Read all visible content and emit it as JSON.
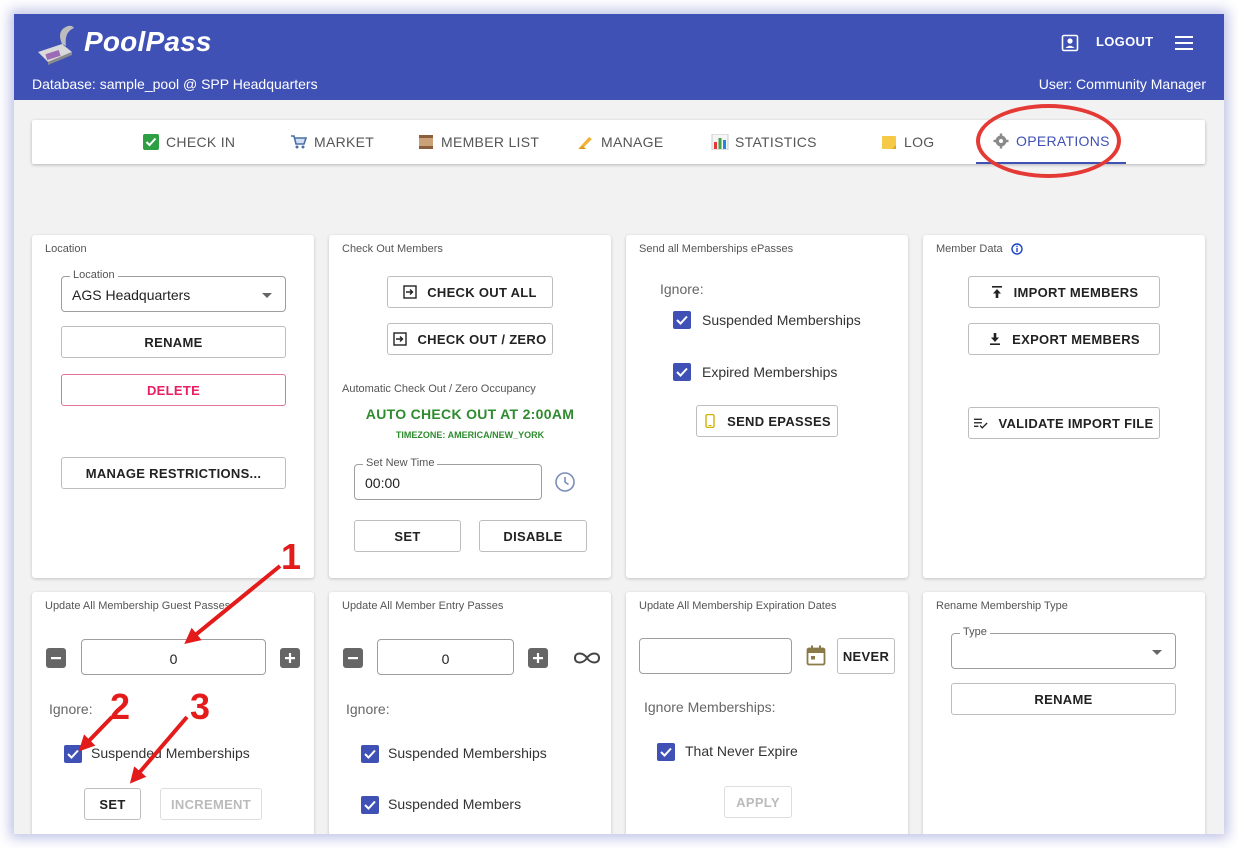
{
  "app": {
    "title": "PoolPass",
    "database_line": "Database: sample_pool @ SPP Headquarters",
    "user_line": "User: Community Manager",
    "logout_label": "LOGOUT",
    "brand_color": "#3f51b5"
  },
  "tabs": [
    {
      "label": "CHECK IN",
      "icon": "check-box-icon"
    },
    {
      "label": "MARKET",
      "icon": "cart-icon"
    },
    {
      "label": "MEMBER LIST",
      "icon": "scroll-icon"
    },
    {
      "label": "MANAGE",
      "icon": "pencil-hand-icon"
    },
    {
      "label": "STATISTICS",
      "icon": "bar-chart-icon"
    },
    {
      "label": "LOG",
      "icon": "note-icon"
    },
    {
      "label": "OPERATIONS",
      "icon": "gear-icon",
      "active": true
    }
  ],
  "location": {
    "title": "Location",
    "field_label": "Location",
    "value": "AGS Headquarters",
    "rename_label": "RENAME",
    "delete_label": "DELETE",
    "restrictions_label": "MANAGE RESTRICTIONS..."
  },
  "checkout": {
    "title": "Check Out Members",
    "check_out_all_label": "CHECK OUT ALL",
    "check_out_zero_label": "CHECK OUT / ZERO",
    "auto_title": "Automatic Check Out / Zero Occupancy",
    "auto_status": "AUTO CHECK OUT AT 2:00AM",
    "timezone": "TIMEZONE: AMERICA/NEW_YORK",
    "time_field_label": "Set New Time",
    "time_value": "00:00",
    "set_label": "SET",
    "disable_label": "DISABLE"
  },
  "epasses": {
    "title": "Send all Memberships ePasses",
    "ignore_label": "Ignore:",
    "opt1": "Suspended Memberships",
    "opt2": "Expired Memberships",
    "send_label": "SEND EPASSES"
  },
  "member_data": {
    "title": "Member Data",
    "import_label": "IMPORT MEMBERS",
    "export_label": "EXPORT MEMBERS",
    "validate_label": "VALIDATE IMPORT FILE"
  },
  "guest_passes": {
    "title": "Update All Membership Guest Passes",
    "value": "0",
    "ignore_label": "Ignore:",
    "opt1": "Suspended Memberships",
    "set_label": "SET",
    "increment_label": "INCREMENT"
  },
  "entry_passes": {
    "title": "Update All Member Entry Passes",
    "value": "0",
    "ignore_label": "Ignore:",
    "opt1": "Suspended Memberships",
    "opt2": "Suspended Members"
  },
  "expiration": {
    "title": "Update All Membership Expiration Dates",
    "never_label": "NEVER",
    "ignore_label": "Ignore Memberships:",
    "opt1": "That Never Expire",
    "apply_label": "APPLY"
  },
  "rename_type": {
    "title": "Rename Membership Type",
    "field_label": "Type",
    "rename_label": "RENAME"
  },
  "annotations": {
    "n1": "1",
    "n2": "2",
    "n3": "3",
    "color": "#e31b1b"
  }
}
